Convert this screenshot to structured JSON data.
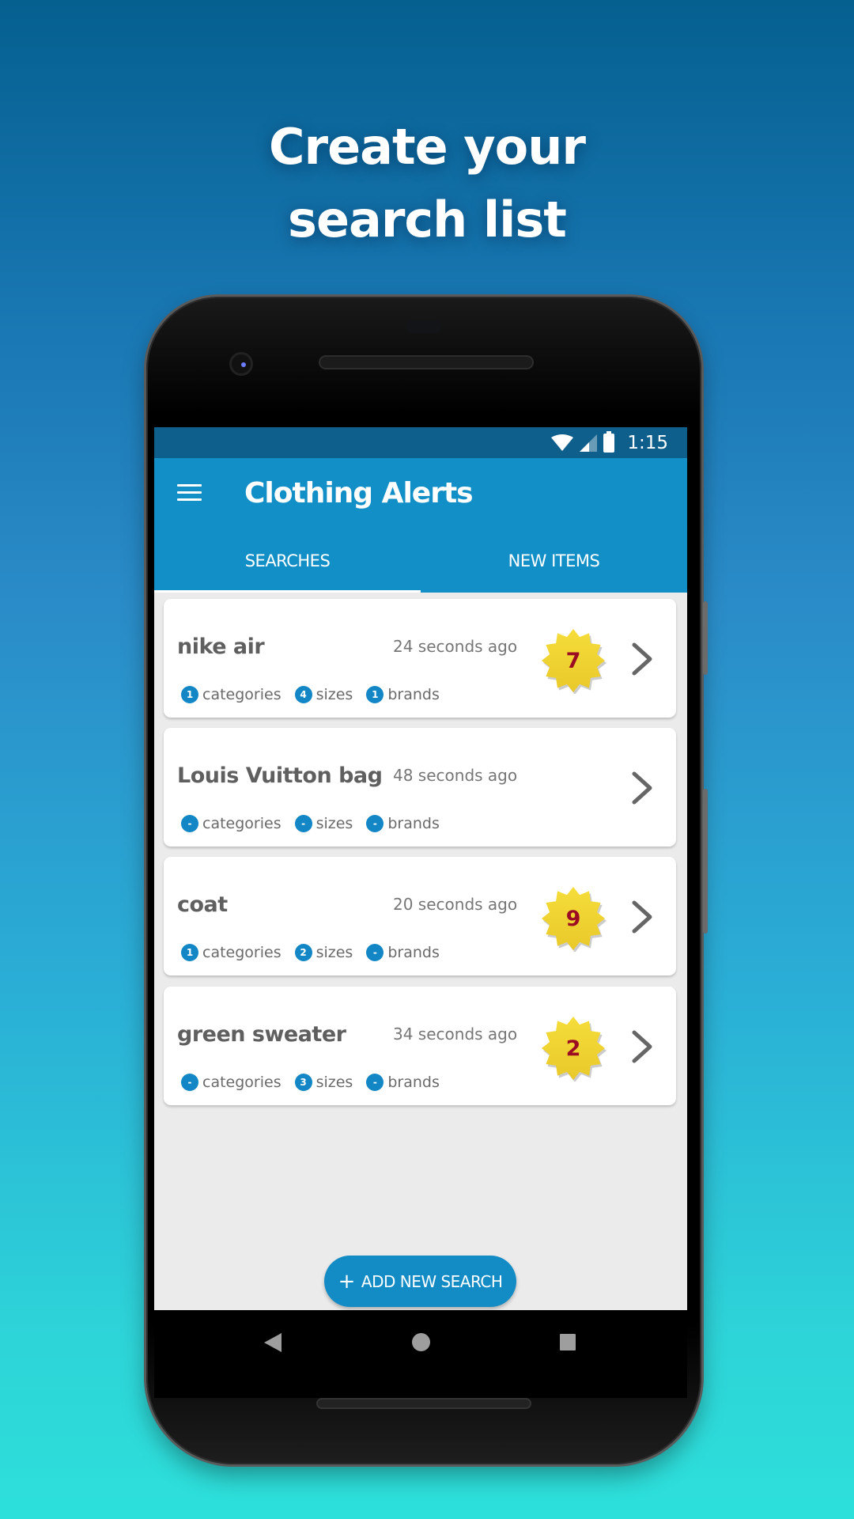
{
  "headline": {
    "line1": "Create your",
    "line2": "search list"
  },
  "status_bar": {
    "time": "1:15",
    "icons": [
      "wifi-icon",
      "signal-icon",
      "battery-icon"
    ]
  },
  "app_bar": {
    "menu_icon": "hamburger-icon",
    "title": "Clothing Alerts"
  },
  "tabs": [
    {
      "label": "SEARCHES",
      "active": true
    },
    {
      "label": "NEW ITEMS",
      "active": false
    }
  ],
  "searches": [
    {
      "title": "nike air",
      "time": "24 seconds ago",
      "categories": "1",
      "sizes": "4",
      "brands": "1",
      "new_count": "7",
      "labels": {
        "categories": "categories",
        "sizes": "sizes",
        "brands": "brands"
      }
    },
    {
      "title": "Louis Vuitton bag",
      "time": "48 seconds ago",
      "categories": "-",
      "sizes": "-",
      "brands": "-",
      "new_count": null,
      "labels": {
        "categories": "categories",
        "sizes": "sizes",
        "brands": "brands"
      }
    },
    {
      "title": "coat",
      "time": "20 seconds ago",
      "categories": "1",
      "sizes": "2",
      "brands": "-",
      "new_count": "9",
      "labels": {
        "categories": "categories",
        "sizes": "sizes",
        "brands": "brands"
      }
    },
    {
      "title": "green sweater",
      "time": "34 seconds ago",
      "categories": "-",
      "sizes": "3",
      "brands": "-",
      "new_count": "2",
      "labels": {
        "categories": "categories",
        "sizes": "sizes",
        "brands": "brands"
      }
    }
  ],
  "add_button": {
    "icon": "+",
    "label": "ADD NEW SEARCH"
  },
  "nav_bar": {
    "icons": [
      "back-icon",
      "home-icon",
      "recents-icon"
    ]
  },
  "colors": {
    "primary": "#138fc7",
    "status_bar": "#0e5f8c",
    "badge_fill": "#f5dd3a",
    "badge_text": "#9a0d22",
    "count_circle": "#1386c5"
  }
}
